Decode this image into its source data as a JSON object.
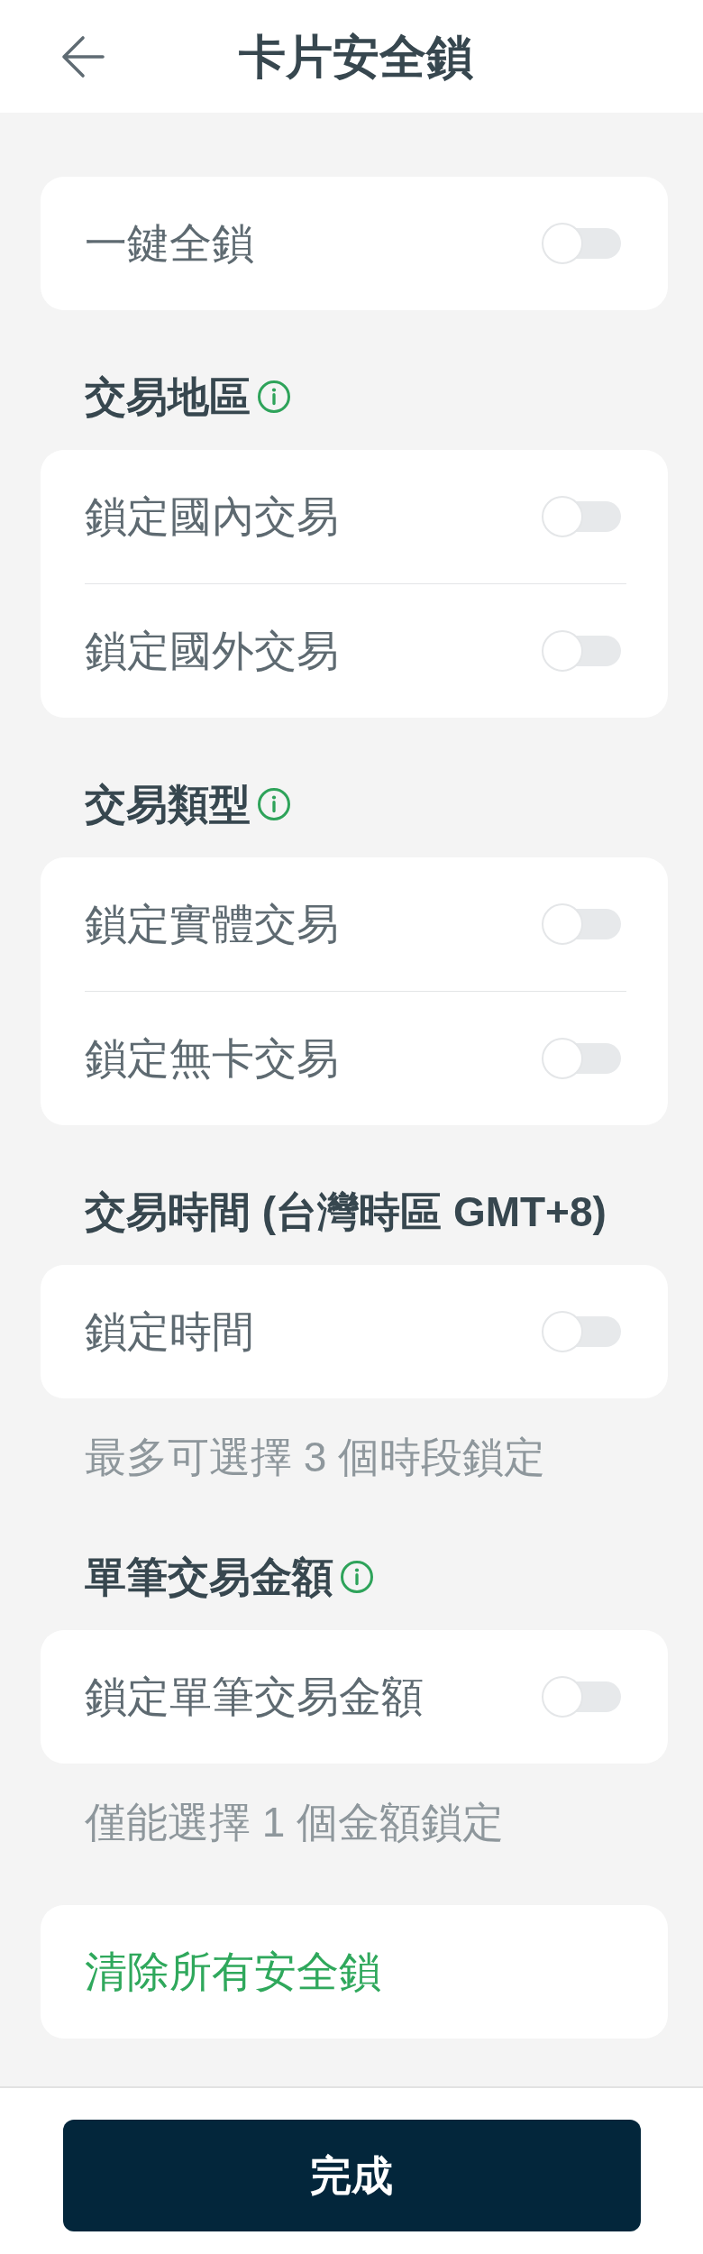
{
  "header": {
    "title": "卡片安全鎖"
  },
  "sections": [
    {
      "toggles": [
        {
          "label": "一鍵全鎖",
          "checked": false
        }
      ]
    },
    {
      "heading": {
        "text": "交易地區",
        "info": true
      },
      "toggles": [
        {
          "label": "鎖定國內交易",
          "checked": false
        },
        {
          "label": "鎖定國外交易",
          "checked": false
        }
      ]
    },
    {
      "heading": {
        "text": "交易類型",
        "info": true
      },
      "toggles": [
        {
          "label": "鎖定實體交易",
          "checked": false
        },
        {
          "label": "鎖定無卡交易",
          "checked": false
        }
      ]
    },
    {
      "heading": {
        "text": "交易時間 (台灣時區 GMT+8)",
        "info": false
      },
      "toggles": [
        {
          "label": "鎖定時間",
          "checked": false
        }
      ],
      "note": "最多可選擇 3 個時段鎖定"
    },
    {
      "heading": {
        "text": "單筆交易金額",
        "info": true
      },
      "toggles": [
        {
          "label": "鎖定單筆交易金額",
          "checked": false
        }
      ],
      "note": "僅能選擇 1 個金額鎖定"
    }
  ],
  "clear_button": "清除所有安全鎖",
  "done_button": "完成"
}
